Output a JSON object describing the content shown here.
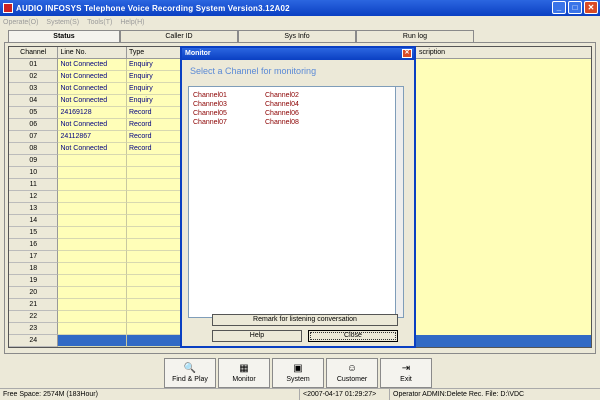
{
  "window": {
    "title": "AUDIO INFOSYS  Telephone Voice Recording System Version3.12A02"
  },
  "menu": [
    "Operate(O)",
    "System(S)",
    "Tools(T)",
    "Help(H)"
  ],
  "tabs": [
    "Status",
    "Caller ID",
    "Sys Info",
    "Run log"
  ],
  "grid": {
    "headers": [
      "Channel",
      "Line No.",
      "Type"
    ],
    "right_header": "scription",
    "rows": [
      {
        "channel": "01",
        "line": "Not Connected",
        "type": "Enquiry"
      },
      {
        "channel": "02",
        "line": "Not Connected",
        "type": "Enquiry"
      },
      {
        "channel": "03",
        "line": "Not Connected",
        "type": "Enquiry"
      },
      {
        "channel": "04",
        "line": "Not Connected",
        "type": "Enquiry"
      },
      {
        "channel": "05",
        "line": "24169128",
        "type": "Record"
      },
      {
        "channel": "06",
        "line": "Not Connected",
        "type": "Record"
      },
      {
        "channel": "07",
        "line": "24112867",
        "type": "Record"
      },
      {
        "channel": "08",
        "line": "Not Connected",
        "type": "Record"
      },
      {
        "channel": "09",
        "line": "",
        "type": ""
      },
      {
        "channel": "10",
        "line": "",
        "type": ""
      },
      {
        "channel": "11",
        "line": "",
        "type": ""
      },
      {
        "channel": "12",
        "line": "",
        "type": ""
      },
      {
        "channel": "13",
        "line": "",
        "type": ""
      },
      {
        "channel": "14",
        "line": "",
        "type": ""
      },
      {
        "channel": "15",
        "line": "",
        "type": ""
      },
      {
        "channel": "16",
        "line": "",
        "type": ""
      },
      {
        "channel": "17",
        "line": "",
        "type": ""
      },
      {
        "channel": "18",
        "line": "",
        "type": ""
      },
      {
        "channel": "19",
        "line": "",
        "type": ""
      },
      {
        "channel": "20",
        "line": "",
        "type": ""
      },
      {
        "channel": "21",
        "line": "",
        "type": ""
      },
      {
        "channel": "22",
        "line": "",
        "type": ""
      },
      {
        "channel": "23",
        "line": "",
        "type": ""
      },
      {
        "channel": "24",
        "line": "",
        "type": ""
      }
    ]
  },
  "monitor": {
    "title": "Monitor",
    "heading": "Select a Channel for monitoring",
    "channels_left": [
      "Channel01",
      "Channel03",
      "Channel05",
      "Channel07"
    ],
    "channels_right": [
      "Channel02",
      "Channel04",
      "Channel06",
      "Channel08"
    ],
    "remark_label": "Remark for listening conversation",
    "help_label": "Help",
    "close_label": "Close"
  },
  "toolbar": [
    {
      "label": "Find & Play",
      "icon": "magnifier-icon"
    },
    {
      "label": "Monitor",
      "icon": "monitor-icon"
    },
    {
      "label": "System",
      "icon": "system-icon"
    },
    {
      "label": "Customer",
      "icon": "customer-icon"
    },
    {
      "label": "Exit",
      "icon": "exit-icon"
    }
  ],
  "statusbar": {
    "free_space": "Free Space: 2574M (183Hour)",
    "datetime": "<2007-04-17 01:29:27>",
    "operator": "Operator ADMIN:Delete Rec. File: D:\\VDC"
  }
}
